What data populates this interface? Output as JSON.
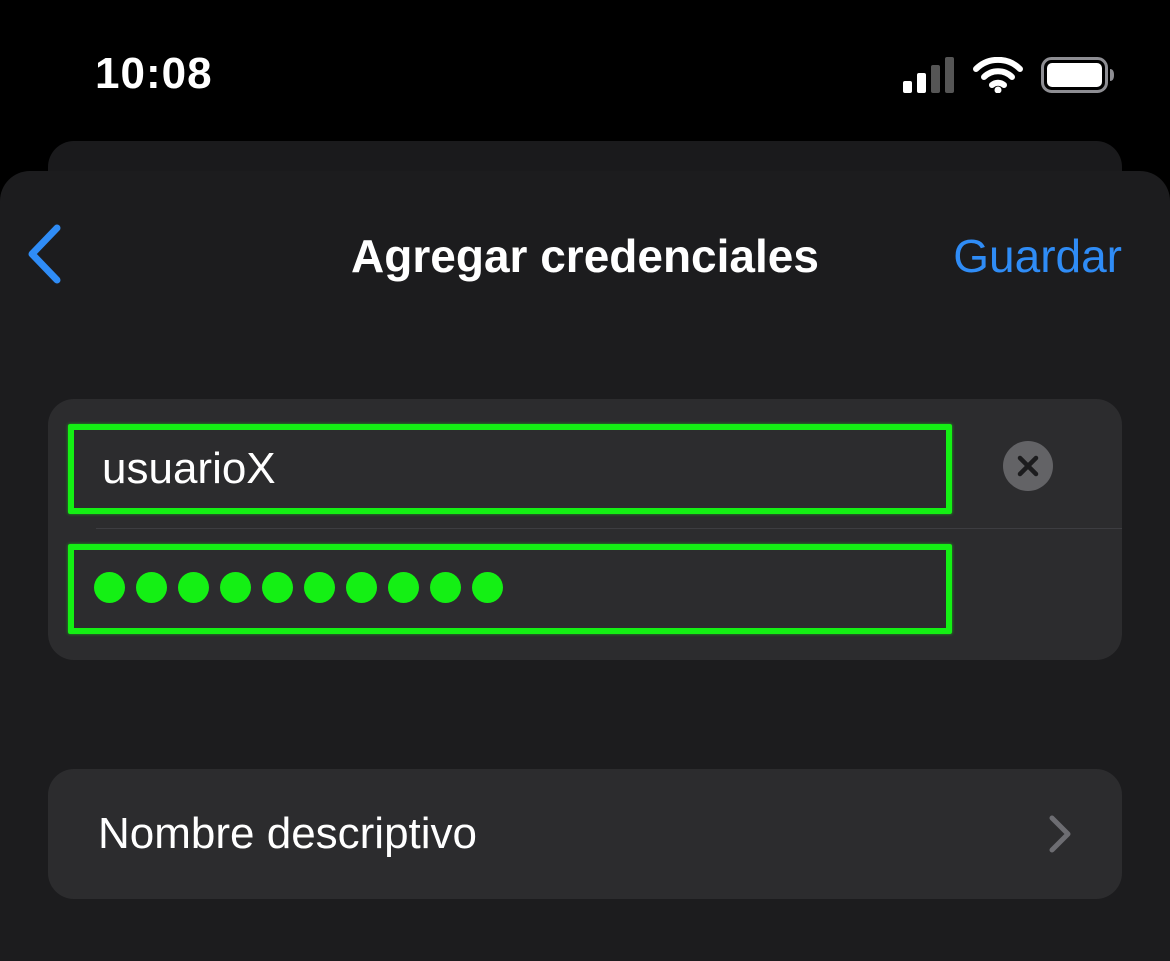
{
  "status_bar": {
    "time": "10:08",
    "icons": [
      "cellular-signal-icon",
      "wifi-icon",
      "battery-icon"
    ]
  },
  "nav": {
    "back_icon": "chevron-left-icon",
    "title": "Agregar credenciales",
    "save_label": "Guardar"
  },
  "credentials": {
    "username_value": "usuarioX",
    "password_masked": "••••••••••",
    "password_length": 10,
    "clear_icon": "clear-x-icon"
  },
  "descriptive_name": {
    "label": "Nombre descriptivo",
    "chevron_icon": "chevron-right-icon"
  },
  "colors": {
    "accent": "#2f8cf6",
    "highlight": "#14f014",
    "background": "#000000",
    "sheet": "#1c1c1e",
    "card": "#2c2c2e"
  }
}
